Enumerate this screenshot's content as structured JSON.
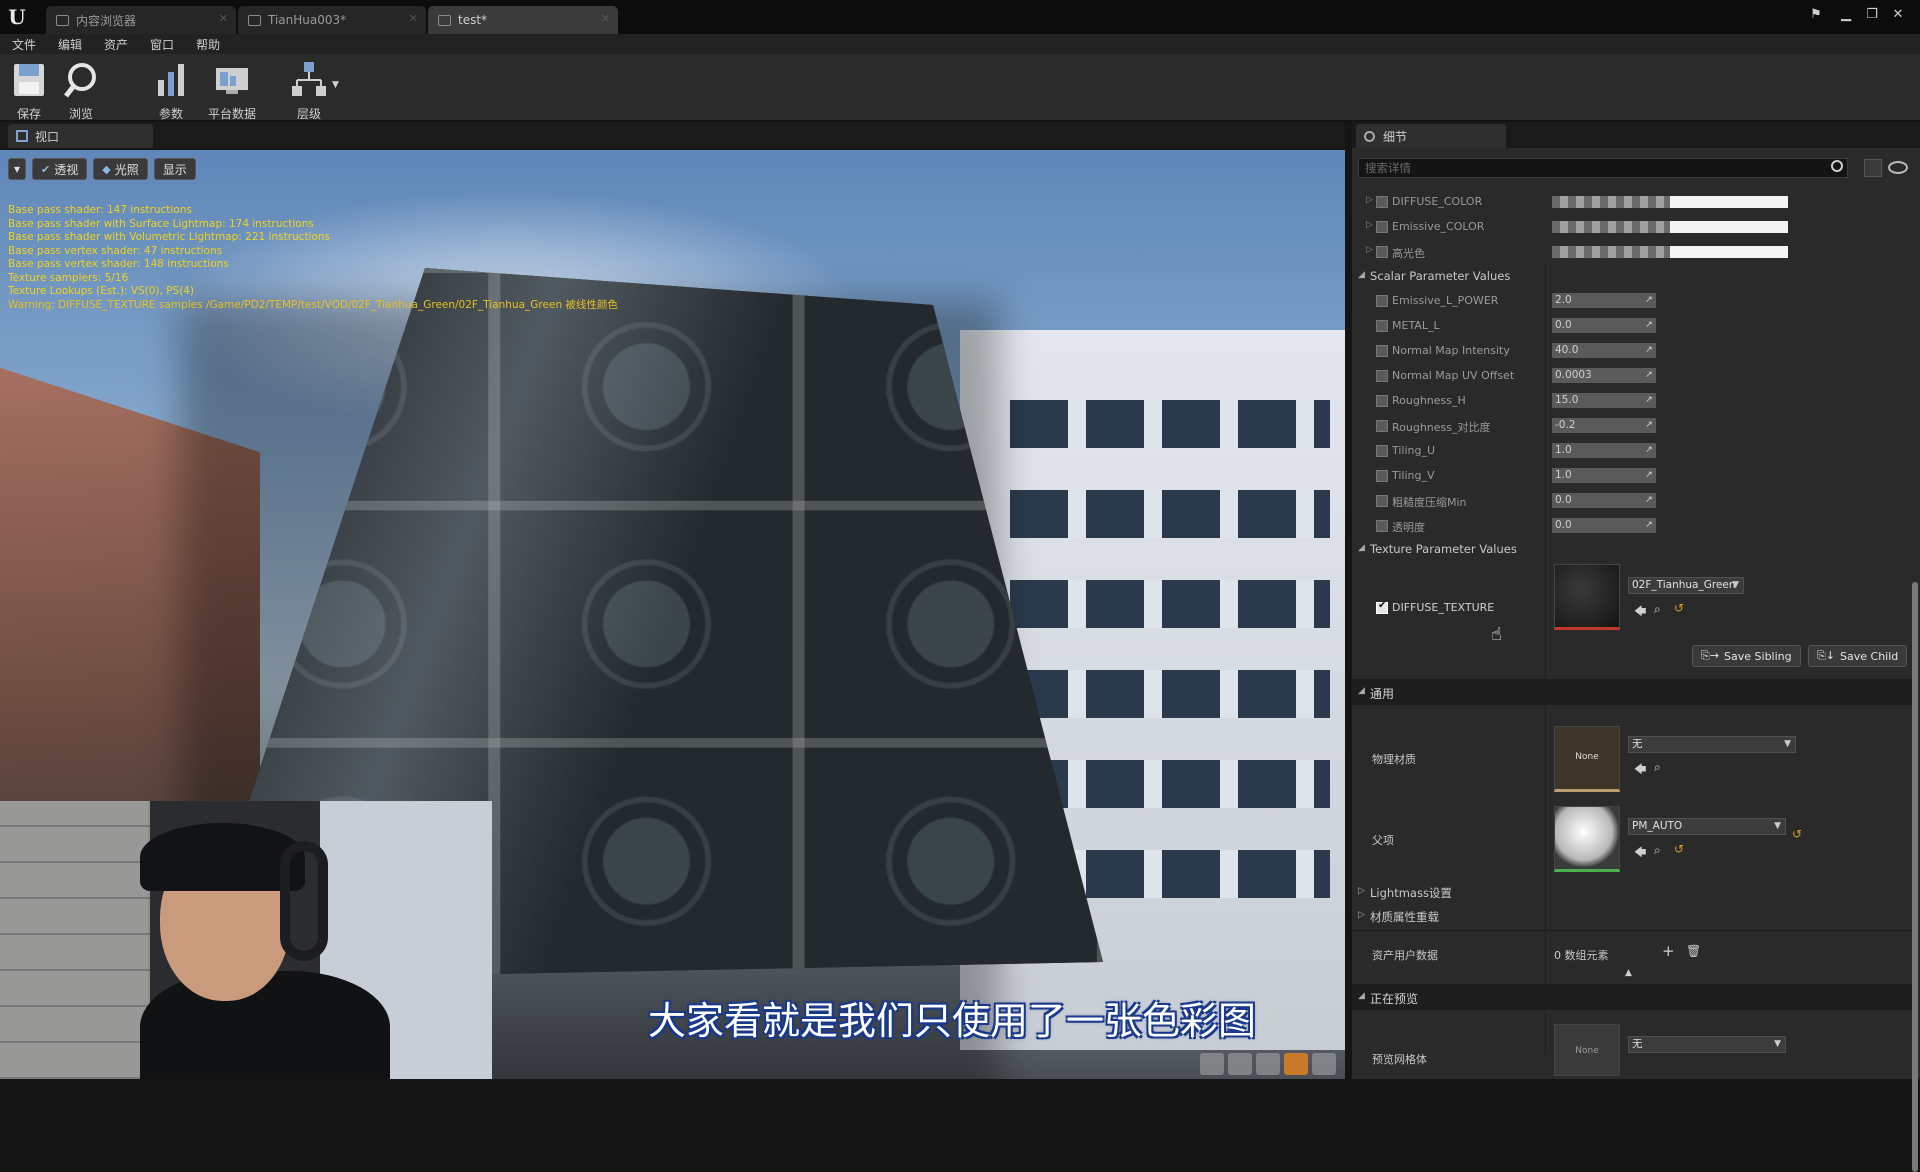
{
  "titlebar": {
    "tabs": [
      {
        "label": "内容浏览器",
        "active": false
      },
      {
        "label": "TianHua003*",
        "active": false
      },
      {
        "label": "test*",
        "active": true
      }
    ]
  },
  "menu": [
    "文件",
    "编辑",
    "资产",
    "窗口",
    "帮助"
  ],
  "toolbar": {
    "save": "保存",
    "browse": "浏览",
    "params": "参数",
    "platform": "平台数据",
    "hierarchy": "层级"
  },
  "viewport": {
    "tab": "视口",
    "perspective": "透视",
    "lit": "光照",
    "show": "显示",
    "stats": [
      "Base pass shader: 147 instructions",
      "Base pass shader with Surface Lightmap: 174 instructions",
      "Base pass shader with Volumetric Lightmap: 221 instructions",
      "Base pass vertex shader: 47 instructions",
      "Base pass vertex shader: 148 instructions",
      "Texture samplers: 5/16",
      "Texture Lookups (Est.): VS(0), PS(4)",
      "Warning: DIFFUSE_TEXTURE samples /Game/PD2/TEMP/test/VOD/02F_Tianhua_Green/02F_Tianhua_Green 被线性颜色"
    ]
  },
  "subtitle": "大家看就是我们只使用了一张色彩图",
  "details": {
    "tab": "细节",
    "search_placeholder": "搜索详情",
    "vector_params": [
      {
        "label": "DIFFUSE_COLOR"
      },
      {
        "label": "Emissive_COLOR"
      },
      {
        "label": "高光色"
      }
    ],
    "scalar_section": "Scalar Parameter Values",
    "scalar_params": [
      {
        "label": "Emissive_L_POWER",
        "value": "2.0"
      },
      {
        "label": "METAL_L",
        "value": "0.0"
      },
      {
        "label": "Normal Map Intensity",
        "value": "40.0"
      },
      {
        "label": "Normal Map UV Offset",
        "value": "0.0003"
      },
      {
        "label": "Roughness_H",
        "value": "15.0"
      },
      {
        "label": "Roughness_对比度",
        "value": "-0.2"
      },
      {
        "label": "Tiling_U",
        "value": "1.0"
      },
      {
        "label": "Tiling_V",
        "value": "1.0"
      },
      {
        "label": "粗糙度压缩Min",
        "value": "0.0"
      },
      {
        "label": "透明度",
        "value": "0.0"
      }
    ],
    "texture_section": "Texture Parameter Values",
    "texture_param": {
      "label": "DIFFUSE_TEXTURE",
      "asset": "02F_Tianhua_Green",
      "checked": true
    },
    "save_sibling": "Save Sibling",
    "save_child": "Save Child",
    "general_section": "通用",
    "phys_material": {
      "label": "物理材质",
      "thumb": "None",
      "value": "无"
    },
    "parent": {
      "label": "父项",
      "value": "PM_AUTO"
    },
    "lightmass": "Lightmass设置",
    "mat_override": "材质属性重载",
    "asset_user_data": {
      "label": "资产用户数据",
      "value": "0 数组元素"
    },
    "previewing_section": "正在预览",
    "preview_mesh": {
      "label": "预览网格体",
      "thumb": "None",
      "value": "无"
    }
  }
}
